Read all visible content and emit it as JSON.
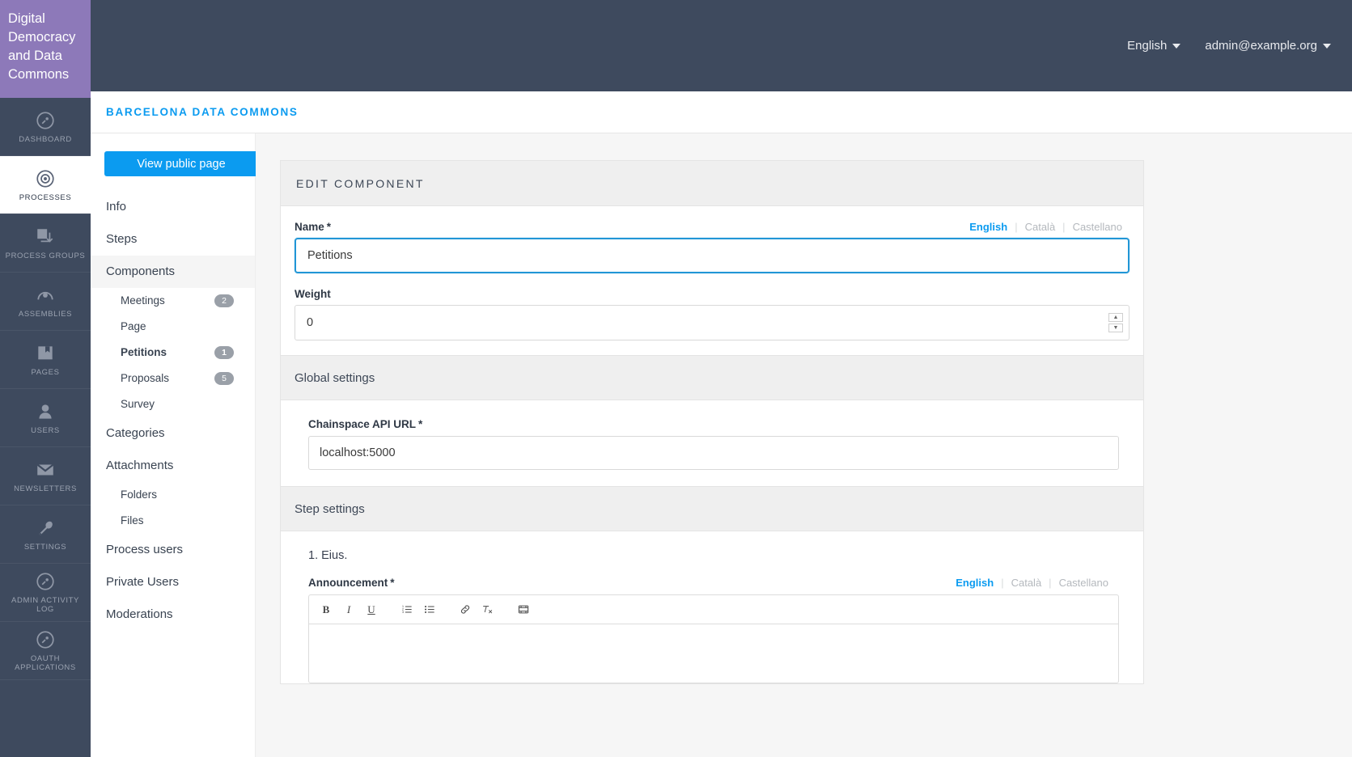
{
  "brand": {
    "title": "Digital Democracy and Data Commons"
  },
  "rail": {
    "items": [
      {
        "label": "Dashboard",
        "icon": "dashboard-icon",
        "active": false
      },
      {
        "label": "Processes",
        "icon": "target-icon",
        "active": true
      },
      {
        "label": "Process groups",
        "icon": "layers-icon",
        "active": false
      },
      {
        "label": "Assemblies",
        "icon": "assembly-icon",
        "active": false
      },
      {
        "label": "Pages",
        "icon": "book-icon",
        "active": false
      },
      {
        "label": "Users",
        "icon": "user-icon",
        "active": false
      },
      {
        "label": "Newsletters",
        "icon": "envelope-icon",
        "active": false
      },
      {
        "label": "Settings",
        "icon": "wrench-icon",
        "active": false
      },
      {
        "label": "Admin activity log",
        "icon": "activity-icon",
        "active": false
      },
      {
        "label": "OAuth applications",
        "icon": "oauth-icon",
        "active": false
      }
    ]
  },
  "topbar": {
    "language": "English",
    "account": "admin@example.org"
  },
  "breadcrumb": {
    "current": "Barcelona Data Commons"
  },
  "subnav": {
    "view_public_label": "View public page",
    "items": [
      {
        "label": "Info",
        "level": 1,
        "badge": null,
        "active": false
      },
      {
        "label": "Steps",
        "level": 1,
        "badge": null,
        "active": false
      },
      {
        "label": "Components",
        "level": 1,
        "badge": null,
        "active": false,
        "highlight": true
      },
      {
        "label": "Meetings",
        "level": 2,
        "badge": "2",
        "active": false
      },
      {
        "label": "Page",
        "level": 2,
        "badge": null,
        "active": false
      },
      {
        "label": "Petitions",
        "level": 2,
        "badge": "1",
        "active": true
      },
      {
        "label": "Proposals",
        "level": 2,
        "badge": "5",
        "active": false
      },
      {
        "label": "Survey",
        "level": 2,
        "badge": null,
        "active": false
      },
      {
        "label": "Categories",
        "level": 1,
        "badge": null,
        "active": false
      },
      {
        "label": "Attachments",
        "level": 1,
        "badge": null,
        "active": false
      },
      {
        "label": "Folders",
        "level": 2,
        "badge": null,
        "active": false
      },
      {
        "label": "Files",
        "level": 2,
        "badge": null,
        "active": false
      },
      {
        "label": "Process users",
        "level": 1,
        "badge": null,
        "active": false
      },
      {
        "label": "Private Users",
        "level": 1,
        "badge": null,
        "active": false
      },
      {
        "label": "Moderations",
        "level": 1,
        "badge": null,
        "active": false
      }
    ]
  },
  "main": {
    "card_title": "Edit component",
    "name_field": {
      "label": "Name",
      "required_mark": "*",
      "value": "Petitions"
    },
    "languages": {
      "english": "English",
      "catala": "Català",
      "castellano": "Castellano",
      "separator": "|"
    },
    "weight_field": {
      "label": "Weight",
      "value": "0",
      "up_arrow": "▲",
      "down_arrow": "▼"
    },
    "global_settings": {
      "heading": "Global settings",
      "api_field": {
        "label": "Chainspace API URL",
        "required_mark": "*",
        "value": "localhost:5000"
      }
    },
    "step_settings": {
      "heading": "Step settings",
      "step_title": "1. Eius.",
      "announcement_field": {
        "label": "Announcement",
        "required_mark": "*",
        "value": ""
      },
      "toolbar": [
        {
          "name": "bold-icon",
          "glyph": "B"
        },
        {
          "name": "italic-icon",
          "glyph": "I"
        },
        {
          "name": "underline-icon",
          "glyph": "U"
        },
        {
          "name": "ordered-list-icon",
          "glyph": ""
        },
        {
          "name": "unordered-list-icon",
          "glyph": ""
        },
        {
          "name": "link-icon",
          "glyph": ""
        },
        {
          "name": "clear-format-icon",
          "glyph": ""
        },
        {
          "name": "video-icon",
          "glyph": ""
        }
      ]
    }
  },
  "colors": {
    "brand_purple": "#8d79b9",
    "rail_dark": "#3e4a5e",
    "accent_blue": "#0b9bf0",
    "focus_blue": "#2196d6"
  }
}
